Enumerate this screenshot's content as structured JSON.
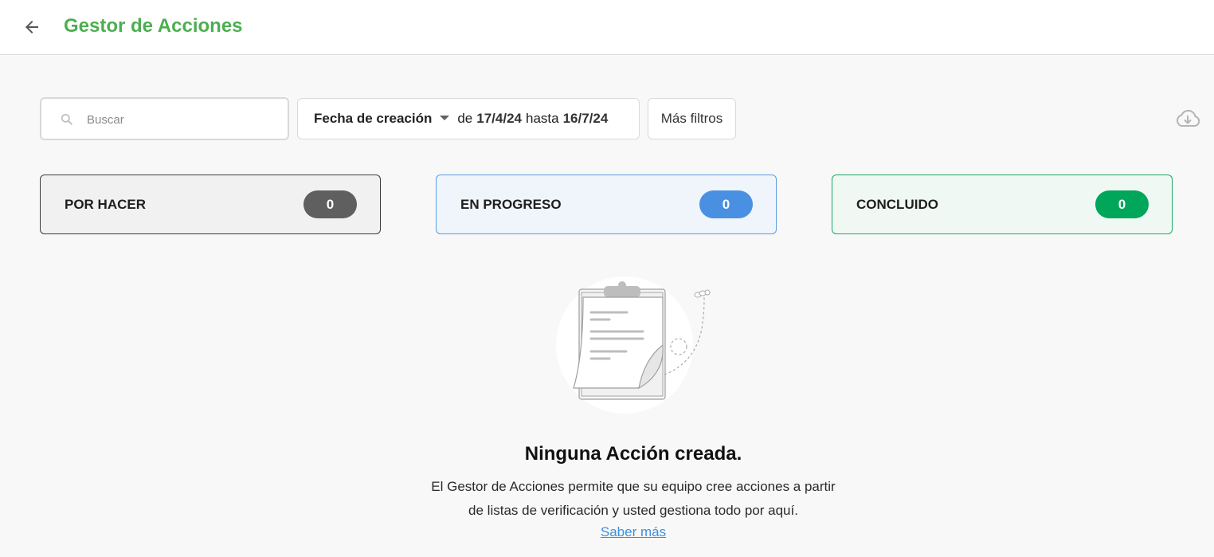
{
  "header": {
    "title": "Gestor de Acciones",
    "title_color": "#4caf50",
    "back_icon": "arrow-left-icon"
  },
  "filters": {
    "search_placeholder": "Buscar",
    "search_value": "",
    "date_field_label": "Fecha de creación",
    "from_word": "de",
    "from_date": "17/4/24",
    "until_word": "hasta",
    "to_date": "16/7/24",
    "more_filters_label": "Más filtros",
    "download_icon": "cloud-download-icon"
  },
  "status_cards": [
    {
      "label": "POR HACER",
      "count": "0",
      "badge_color": "#5f5f5f"
    },
    {
      "label": "EN PROGRESO",
      "count": "0",
      "badge_color": "#4a90e2"
    },
    {
      "label": "CONCLUIDO",
      "count": "0",
      "badge_color": "#00a65a"
    }
  ],
  "empty_state": {
    "illustration_icon": "clipboard-icon",
    "title": "Ninguna Acción creada.",
    "description": "El Gestor de Acciones permite que su equipo cree acciones a partir de listas de verificación y usted gestiona todo por aquí.",
    "link_label": "Saber más",
    "link_color": "#3d8fe0"
  }
}
